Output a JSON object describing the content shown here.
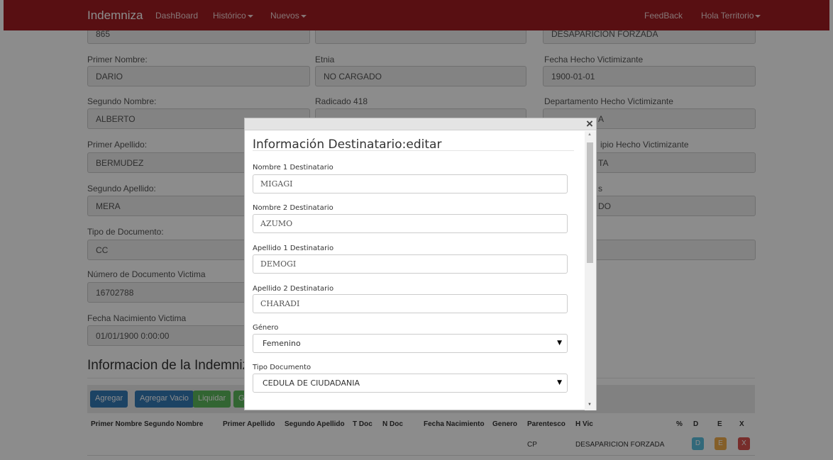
{
  "navbar": {
    "brand": "Indemniza",
    "dashboard": "DashBoard",
    "historico": "Histórico",
    "nuevos": "Nuevos",
    "feedback": "FeedBack",
    "user_menu": "Hola Territorio"
  },
  "form": {
    "top_row": {
      "col1": "865",
      "col2": "",
      "col3": "DESAPARICION FORZADA"
    },
    "primer_nombre": {
      "label": "Primer Nombre:",
      "value": "DARIO"
    },
    "etnia": {
      "label": "Etnia",
      "value": "NO CARGADO"
    },
    "fecha_hecho": {
      "label": "Fecha Hecho Victimizante",
      "value": "1900-01-01"
    },
    "segundo_nombre": {
      "label": "Segundo Nombre:",
      "value": "ALBERTO"
    },
    "radicado": {
      "label": "Radicado 418",
      "value": ""
    },
    "depto_hecho": {
      "label": "Departamento Hecho Victimizante",
      "value_visible": "A"
    },
    "primer_apellido": {
      "label": "Primer Apellido:",
      "value": "BERMUDEZ"
    },
    "municipio_hecho": {
      "label_visible": "ipio Hecho Victimizante",
      "value_visible": "TA"
    },
    "segundo_apellido": {
      "label": "Segundo Apellido:",
      "value": "MERA"
    },
    "col3_row5": {
      "label_visible": "s",
      "value_visible": "DO"
    },
    "tipo_documento": {
      "label": "Tipo de Documento:",
      "value": "CC"
    },
    "numero_documento": {
      "label": "Número de Documento Victima",
      "value": "16702788"
    },
    "fecha_nacimiento": {
      "label": "Fecha Nacimiento Victima",
      "value": "01/01/1900 0:00:00"
    }
  },
  "indemnizacion": {
    "title": "Informacion de la Indemnizac",
    "buttons": {
      "agregar": "Agregar",
      "agregar_vacio": "Agregar Vacio",
      "liquidar": "Liquidar",
      "partial": "G"
    },
    "columns": [
      "Primer Nombre",
      "Segundo Nombre",
      "Primer Apellido",
      "Segundo Apellido",
      "T Doc",
      "N Doc",
      "Fecha Nacimiento",
      "Genero",
      "Parentesco",
      "H Vic",
      "%",
      "D",
      "E",
      "X"
    ],
    "rows": [
      {
        "parentesco": "CP",
        "h_vic": "DESAPARICION FORZADA",
        "d": "D",
        "e": "E",
        "x": "X"
      }
    ]
  },
  "modal": {
    "title": "Información Destinatario:editar",
    "close": "×",
    "fields": {
      "nombre1": {
        "label": "Nombre 1 Destinatario",
        "value": "MIGAGI"
      },
      "nombre2": {
        "label": "Nombre 2 Destinatario",
        "value": "AZUMO"
      },
      "apellido1": {
        "label": "Apellido 1 Destinatario",
        "value": "DEMOGI"
      },
      "apellido2": {
        "label": "Apellido 2 Destinatario",
        "value": "CHARADI"
      },
      "genero": {
        "label": "Género",
        "value": "Femenino"
      },
      "tipo_documento": {
        "label": "Tipo Documento",
        "value": "CEDULA DE CIUDADANIA"
      }
    }
  },
  "colors": {
    "navbar": "#a01c22",
    "primary": "#337ab7",
    "success": "#5cb85c",
    "info": "#5bc0de",
    "warning": "#f0ad4e",
    "danger": "#d9534f"
  }
}
